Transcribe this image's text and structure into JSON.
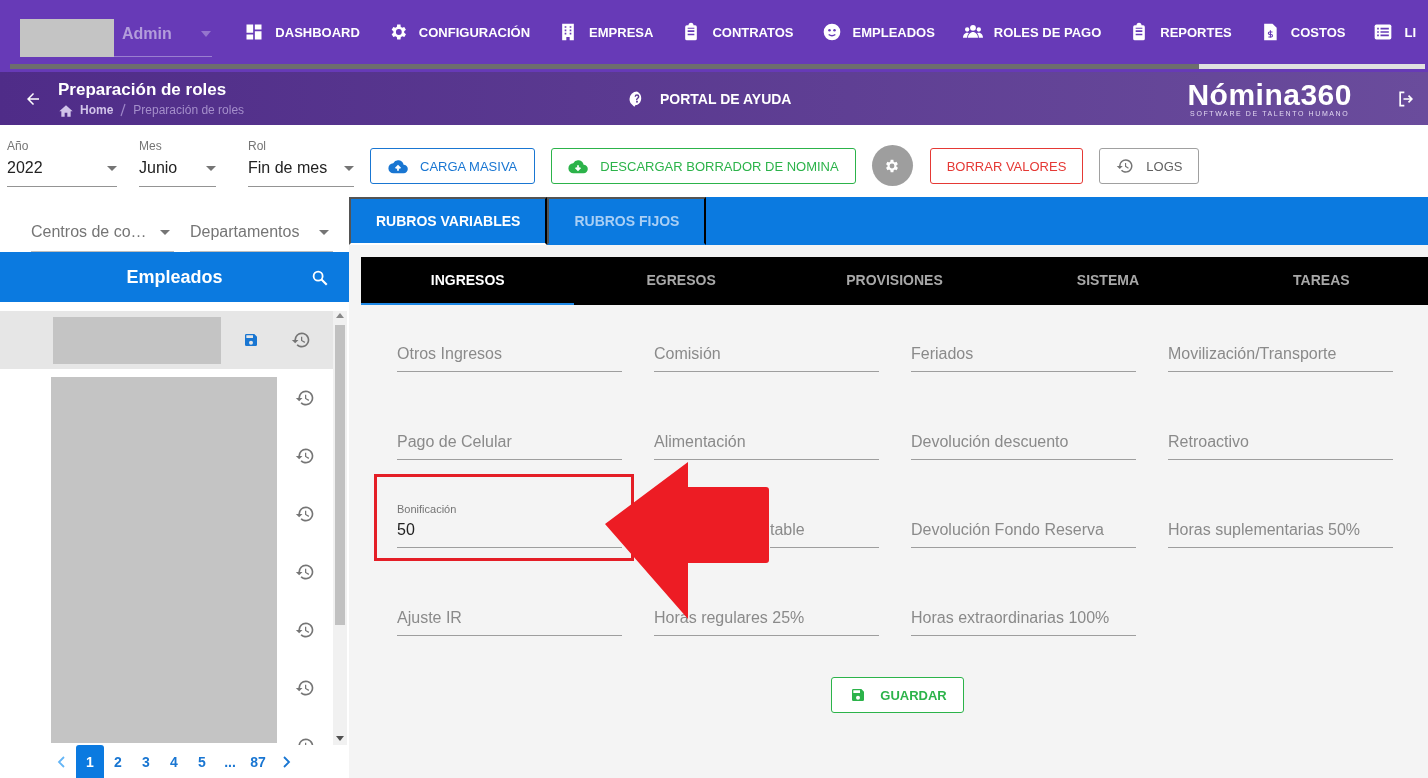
{
  "topbar": {
    "user": "Admin",
    "nav": [
      {
        "label": "DASHBOARD"
      },
      {
        "label": "CONFIGURACIÓN"
      },
      {
        "label": "EMPRESA"
      },
      {
        "label": "CONTRATOS"
      },
      {
        "label": "EMPLEADOS"
      },
      {
        "label": "ROLES DE PAGO"
      },
      {
        "label": "REPORTES"
      },
      {
        "label": "COSTOS"
      },
      {
        "label": "LI"
      }
    ],
    "loading_bar": {
      "level": 0.84
    }
  },
  "header": {
    "title": "Preparación de roles",
    "breadcrumb": [
      "Home",
      "Preparación de roles"
    ],
    "help": "PORTAL DE AYUDA",
    "logo": "Nómina360",
    "logo_tagline": "SOFTWARE DE TALENTO HUMANO"
  },
  "filters": [
    {
      "label": "Año",
      "value": "2022"
    },
    {
      "label": "Mes",
      "value": "Junio"
    },
    {
      "label": "Rol",
      "value": "Fin de mes"
    }
  ],
  "actions": [
    {
      "kind": "upload",
      "label": "CARGA MASIVA"
    },
    {
      "kind": "download",
      "label": "DESCARGAR BORRADOR DE NOMINA"
    },
    {
      "kind": "settings"
    },
    {
      "kind": "danger",
      "label": "BORRAR VALORES"
    },
    {
      "kind": "history",
      "label": "LOGS"
    }
  ],
  "sidebar": {
    "filters": [
      {
        "placeholder": "Centros de co…"
      },
      {
        "placeholder": "Departamentos"
      }
    ],
    "title": "Empleados",
    "rows": [
      {
        "selected": true
      },
      {
        "selected": false
      },
      {
        "selected": false
      },
      {
        "selected": false
      },
      {
        "selected": false
      },
      {
        "selected": false
      },
      {
        "selected": false
      },
      {
        "selected": false
      }
    ],
    "pagination": [
      {
        "label": "1",
        "selected": true
      },
      {
        "label": "2",
        "selected": false
      },
      {
        "label": "3",
        "selected": false
      },
      {
        "label": "4",
        "selected": false
      },
      {
        "label": "5",
        "selected": false
      },
      {
        "label": "...",
        "selected": false
      },
      {
        "label": "87",
        "selected": false
      }
    ]
  },
  "tabs": [
    {
      "label": "RUBROS VARIABLES",
      "selected": true
    },
    {
      "label": "RUBROS FIJOS",
      "selected": false
    }
  ],
  "subtabs": [
    {
      "label": "INGRESOS",
      "selected": true
    },
    {
      "label": "EGRESOS",
      "selected": false
    },
    {
      "label": "PROVISIONES",
      "selected": false
    },
    {
      "label": "SISTEMA",
      "selected": false
    },
    {
      "label": "TAREAS",
      "selected": false
    }
  ],
  "fields": [
    {
      "kind": "empty",
      "label": "Otros Ingresos"
    },
    {
      "kind": "empty",
      "label": "Comisión"
    },
    {
      "kind": "empty",
      "label": "Feriados"
    },
    {
      "kind": "empty",
      "label": "Movilización/Transporte"
    },
    {
      "kind": "empty",
      "label": "Pago de Celular"
    },
    {
      "kind": "empty",
      "label": "Alimentación"
    },
    {
      "kind": "empty",
      "label": "Devolución descuento"
    },
    {
      "kind": "empty",
      "label": "Retroactivo"
    },
    {
      "kind": "filled",
      "label": "Bonificación",
      "value": "50",
      "highlighted": true
    },
    {
      "kind": "covered",
      "label": "table"
    },
    {
      "kind": "empty",
      "label": "Devolución Fondo Reserva"
    },
    {
      "kind": "empty",
      "label": "Horas suplementarias 50%"
    },
    {
      "kind": "empty",
      "label": "Ajuste IR"
    },
    {
      "kind": "empty",
      "label": "Horas regulares 25%"
    },
    {
      "kind": "empty",
      "label": "Horas extraordinarias 100%"
    }
  ],
  "save_button": "GUARDAR"
}
